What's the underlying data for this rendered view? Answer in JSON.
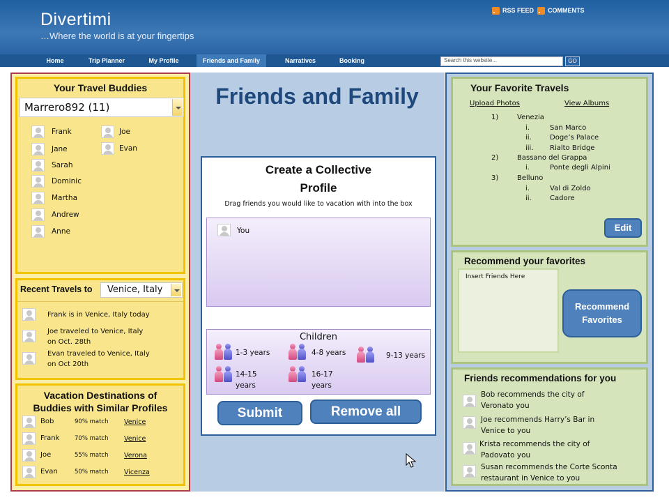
{
  "header": {
    "brand": "Divertimi",
    "tagline": "…Where the world is at your fingertips",
    "rss_label": "RSS FEED",
    "comments_label": "COMMENTS"
  },
  "nav": {
    "items": [
      "Home",
      "Trip Planner",
      "My Profile",
      "Friends and Family",
      "Narratives",
      "Booking"
    ],
    "active": "Friends and Family",
    "search_placeholder": "Search this website...",
    "search_button": "GO"
  },
  "page_title": "Friends and Family",
  "travel_buddies": {
    "title": "Your Travel Buddies",
    "selected_user": "Marrero892 (11)",
    "col1": [
      "Frank",
      "Jane",
      "Sarah",
      "Dominic",
      "Martha",
      "Andrew",
      "Anne"
    ],
    "col2": [
      "Joe",
      "Evan"
    ]
  },
  "recent_travels": {
    "label": "Recent Travels to",
    "selected": "Venice, Italy",
    "items": [
      {
        "line1": "Frank is in Venice, Italy today",
        "line2": ""
      },
      {
        "line1": "Joe traveled to Venice, Italy",
        "line2": "on Oct. 28th"
      },
      {
        "line1": "Evan traveled to Venice, Italy",
        "line2": "on Oct 20th"
      }
    ]
  },
  "similar_profiles": {
    "title_line1": "Vacation Destinations of",
    "title_line2": "Buddies with Similar Profiles",
    "rows": [
      {
        "name": "Bob",
        "match": "90% match",
        "city": "Venice"
      },
      {
        "name": "Frank",
        "match": "70% match",
        "city": "Venice"
      },
      {
        "name": "Joe",
        "match": "55% match",
        "city": "Verona"
      },
      {
        "name": "Evan",
        "match": "50% match",
        "city": "Vicenza"
      }
    ]
  },
  "collective": {
    "title_line1": "Create a Collective",
    "title_line2": "Profile",
    "instructions": "Drag friends you would like to vacation with into the box",
    "member": "You",
    "children_title": "Children",
    "age_groups": [
      {
        "line1": "1-3 years",
        "line2": ""
      },
      {
        "line1": "4-8 years",
        "line2": ""
      },
      {
        "line1": "9-13 years",
        "line2": ""
      },
      {
        "line1": "14-15",
        "line2": "years"
      },
      {
        "line1": "16-17",
        "line2": "years"
      }
    ],
    "submit": "Submit",
    "remove_all": "Remove all"
  },
  "favorite_travels": {
    "title": "Your Favorite Travels",
    "upload": "Upload Photos",
    "albums": "View Albums",
    "edit": "Edit",
    "list": [
      {
        "num": "1)",
        "name": "Venezia",
        "subs": [
          {
            "n": "i.",
            "t": "San Marco"
          },
          {
            "n": "ii.",
            "t": "Doge’s Palace"
          },
          {
            "n": "iii.",
            "t": "Rialto Bridge"
          }
        ]
      },
      {
        "num": "2)",
        "name": "Bassano del Grappa",
        "subs": [
          {
            "n": "i.",
            "t": "Ponte degli Alpini"
          }
        ]
      },
      {
        "num": "3)",
        "name": "Belluno",
        "subs": [
          {
            "n": "i.",
            "t": "Val di Zoldo"
          },
          {
            "n": "ii.",
            "t": "Cadore"
          }
        ]
      }
    ]
  },
  "recommend": {
    "title": "Recommend your favorites",
    "insert_placeholder": "Insert Friends Here",
    "button_line1": "Recommend",
    "button_line2": "Favorites"
  },
  "friends_recs": {
    "title": "Friends recommendations for you",
    "items": [
      {
        "line1": "Bob recommends the city of",
        "line2": "Veronato you"
      },
      {
        "line1": "Joe recommends Harry’s Bar in",
        "line2": "Venice to you"
      },
      {
        "line1": "Krista recommends the city of",
        "line2": "Padovato you"
      },
      {
        "line1": "Susan recommends the Corte Sconta",
        "line2": "restaurant in Venice to you"
      }
    ]
  },
  "colors": {
    "header": "#2a64a5",
    "yellow_panel": "#f8e58c",
    "green_panel": "#d6e4bc",
    "button_blue": "#4f81bd",
    "title_blue": "#1f497d"
  }
}
